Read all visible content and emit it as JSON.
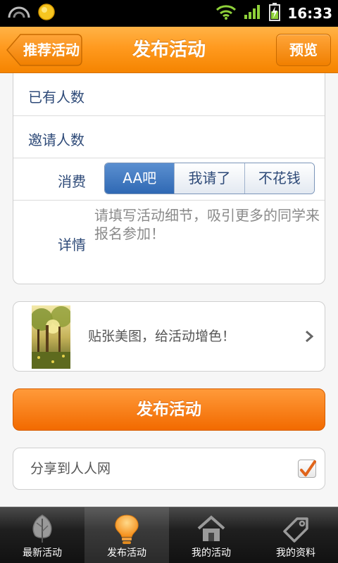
{
  "status_bar": {
    "time": "16:33"
  },
  "title_bar": {
    "back_label": "推荐活动",
    "title": "发布活动",
    "preview_label": "预览"
  },
  "form": {
    "existing_count_label": "已有人数",
    "invite_count_label": "邀请人数",
    "cost_label": "消费",
    "cost_options": [
      "AA吧",
      "我请了",
      "不花钱"
    ],
    "cost_selected": "AA吧",
    "detail_label": "详情",
    "detail_placeholder": "请填写活动细节，吸引更多的同学来报名参加！"
  },
  "image_picker": {
    "hint": "贴张美图，给活动增色！"
  },
  "publish_button": "发布活动",
  "share": {
    "label": "分享到人人网",
    "checked": true
  },
  "tabs": [
    {
      "label": "最新活动",
      "icon": "leaf-icon",
      "active": false
    },
    {
      "label": "发布活动",
      "icon": "lightbulb-icon",
      "active": true
    },
    {
      "label": "我的活动",
      "icon": "home-icon",
      "active": false
    },
    {
      "label": "我的资料",
      "icon": "tag-icon",
      "active": false
    }
  ],
  "colors": {
    "accent": "#f58400",
    "selected_segment": "#2f69b4",
    "label_text": "#2e4a78"
  }
}
